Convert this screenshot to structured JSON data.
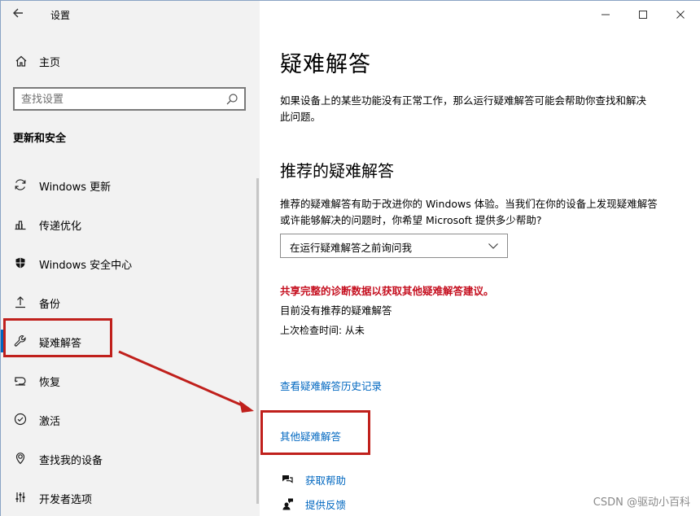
{
  "window": {
    "title": "设置",
    "controls": {
      "minimize": "minimize-icon",
      "maximize": "maximize-icon",
      "close": "close-icon"
    }
  },
  "sidebar": {
    "home_label": "主页",
    "search_placeholder": "查找设置",
    "section_title": "更新和安全",
    "items": [
      {
        "label": "Windows 更新",
        "icon": "sync-icon"
      },
      {
        "label": "传递优化",
        "icon": "delivery-optimization-icon"
      },
      {
        "label": "Windows 安全中心",
        "icon": "shield-icon"
      },
      {
        "label": "备份",
        "icon": "backup-icon"
      },
      {
        "label": "疑难解答",
        "icon": "wrench-icon",
        "active": true
      },
      {
        "label": "恢复",
        "icon": "recovery-icon"
      },
      {
        "label": "激活",
        "icon": "check-circle-icon"
      },
      {
        "label": "查找我的设备",
        "icon": "find-device-icon"
      },
      {
        "label": "开发者选项",
        "icon": "developer-icon"
      }
    ]
  },
  "main": {
    "page_title": "疑难解答",
    "intro": "如果设备上的某些功能没有正常工作，那么运行疑难解答可能会帮助你查找和解决此问题。",
    "recommended_title": "推荐的疑难解答",
    "recommended_desc": "推荐的疑难解答有助于改进你的 Windows 体验。当我们在你的设备上发现疑难解答或许能够解决的问题时，你希望 Microsoft 提供多少帮助?",
    "dropdown_value": "在运行疑难解答之前询问我",
    "diag_link": "共享完整的诊断数据以获取其他疑难解答建议。",
    "none_text": "目前没有推荐的疑难解答",
    "last_check": "上次检查时间: 从未",
    "history_link": "查看疑难解答历史记录",
    "other_link": "其他疑难解答",
    "get_help": "获取帮助",
    "feedback": "提供反馈"
  },
  "watermark": "CSDN @驱动小百科",
  "colors": {
    "accent": "#0067c0",
    "warning": "#c50f1f",
    "annotation": "#c0201c",
    "sidebar_bg": "#f2f2f2"
  }
}
